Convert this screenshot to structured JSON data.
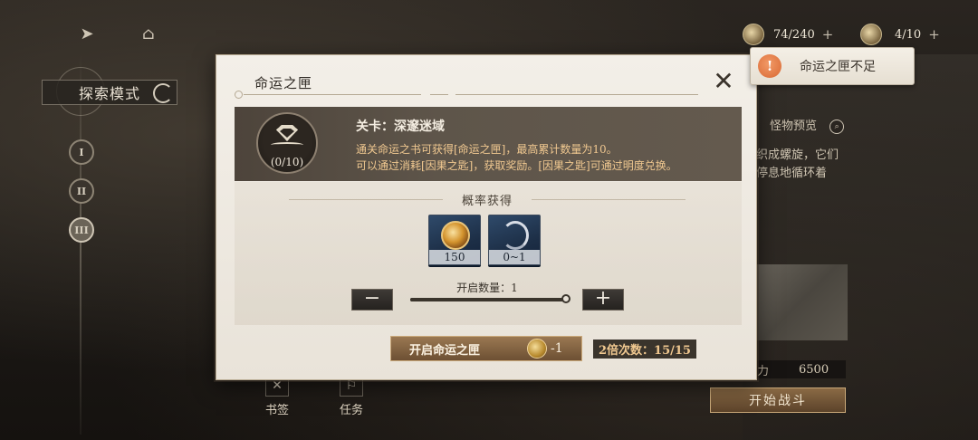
{
  "top": {
    "stamina": "74/240",
    "keys": "4/10"
  },
  "mode": {
    "label": "探索模式"
  },
  "stages": [
    "I",
    "II",
    "III"
  ],
  "toast": {
    "message": "命运之匣不足"
  },
  "right": {
    "monster_preview": "怪物预览",
    "desc_line1": "交织成螺旋，它们",
    "desc_line2": "不停息地循环着",
    "power_label": "力",
    "power_value": "6500",
    "start_battle": "开始战斗"
  },
  "bottom_tabs": [
    {
      "label": "书签"
    },
    {
      "label": "任务"
    }
  ],
  "modal": {
    "title": "命运之匣",
    "banner": {
      "count": "(0/10)",
      "stage_title": "关卡：深邃迷域",
      "line1": "通关命运之书可获得[命运之匣]，最高累计数量为10。",
      "line2": "可以通过消耗[因果之匙]，获取奖励。[因果之匙]可通过明度兑换。"
    },
    "probability_label": "概率获得",
    "rewards": [
      {
        "name": "golden-orb",
        "qty": "150"
      },
      {
        "name": "silver-swirl",
        "qty": "0~1"
      }
    ],
    "open_qty_label": "开启数量：1",
    "open_qty_value": 1,
    "open_qty_max": 1,
    "open_button": "开启命运之匣",
    "open_cost": "-1",
    "double_count": "2倍次数：15/15"
  }
}
